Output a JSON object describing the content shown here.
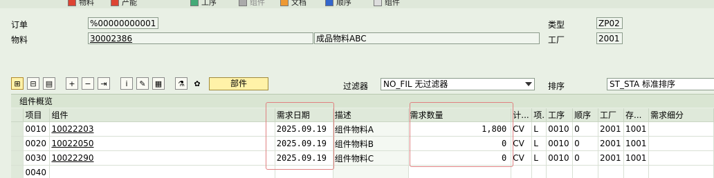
{
  "toolbar": {
    "items": [
      "物料",
      "产能",
      "工序",
      "组件",
      "文档",
      "顺序",
      "组件"
    ]
  },
  "header": {
    "order_label": "订单",
    "order_value": "%00000000001",
    "material_label": "物料",
    "material_value": "30002386",
    "material_desc": "成品物料ABC",
    "type_label": "类型",
    "type_value": "ZP02",
    "plant_label": "工厂",
    "plant_value": "2001"
  },
  "buttonbar": {
    "parts_label": "部件",
    "filter_label": "过滤器",
    "filter_value": "NO_FIL 无过滤器",
    "sort_label": "排序",
    "sort_value": "ST_STA 标准排序"
  },
  "grid": {
    "title": "组件概览",
    "columns": [
      "项目",
      "组件",
      "需求日期",
      "描述",
      "需求数量",
      "计...",
      "项.",
      "工序",
      "顺序",
      "工厂",
      "存...",
      "需求细分"
    ],
    "rows": [
      {
        "item": "0010",
        "component": "10022203",
        "date": "2025.09.19",
        "desc": "组件物料A",
        "qty": "1,800",
        "unit": "CV",
        "cat": "L",
        "op": "0010",
        "seq": "0",
        "plant": "2001",
        "sloc": "1001",
        "seg": ""
      },
      {
        "item": "0020",
        "component": "10022050",
        "date": "2025.09.19",
        "desc": "组件物料B",
        "qty": "0",
        "unit": "CV",
        "cat": "L",
        "op": "0010",
        "seq": "0",
        "plant": "2001",
        "sloc": "1001",
        "seg": ""
      },
      {
        "item": "0030",
        "component": "10022290",
        "date": "2025.09.19",
        "desc": "组件物料C",
        "qty": "0",
        "unit": "CV",
        "cat": "L",
        "op": "0010",
        "seq": "0",
        "plant": "2001",
        "sloc": "1001",
        "seg": ""
      },
      {
        "item": "0040",
        "component": "",
        "date": "",
        "desc": "",
        "qty": "",
        "unit": "",
        "cat": "",
        "op": "",
        "seq": "",
        "plant": "",
        "sloc": "",
        "seg": ""
      }
    ]
  },
  "colors": {
    "background": "#e9f0e5",
    "highlight_box": "#e08080",
    "parts_button": "#fff2a8"
  }
}
